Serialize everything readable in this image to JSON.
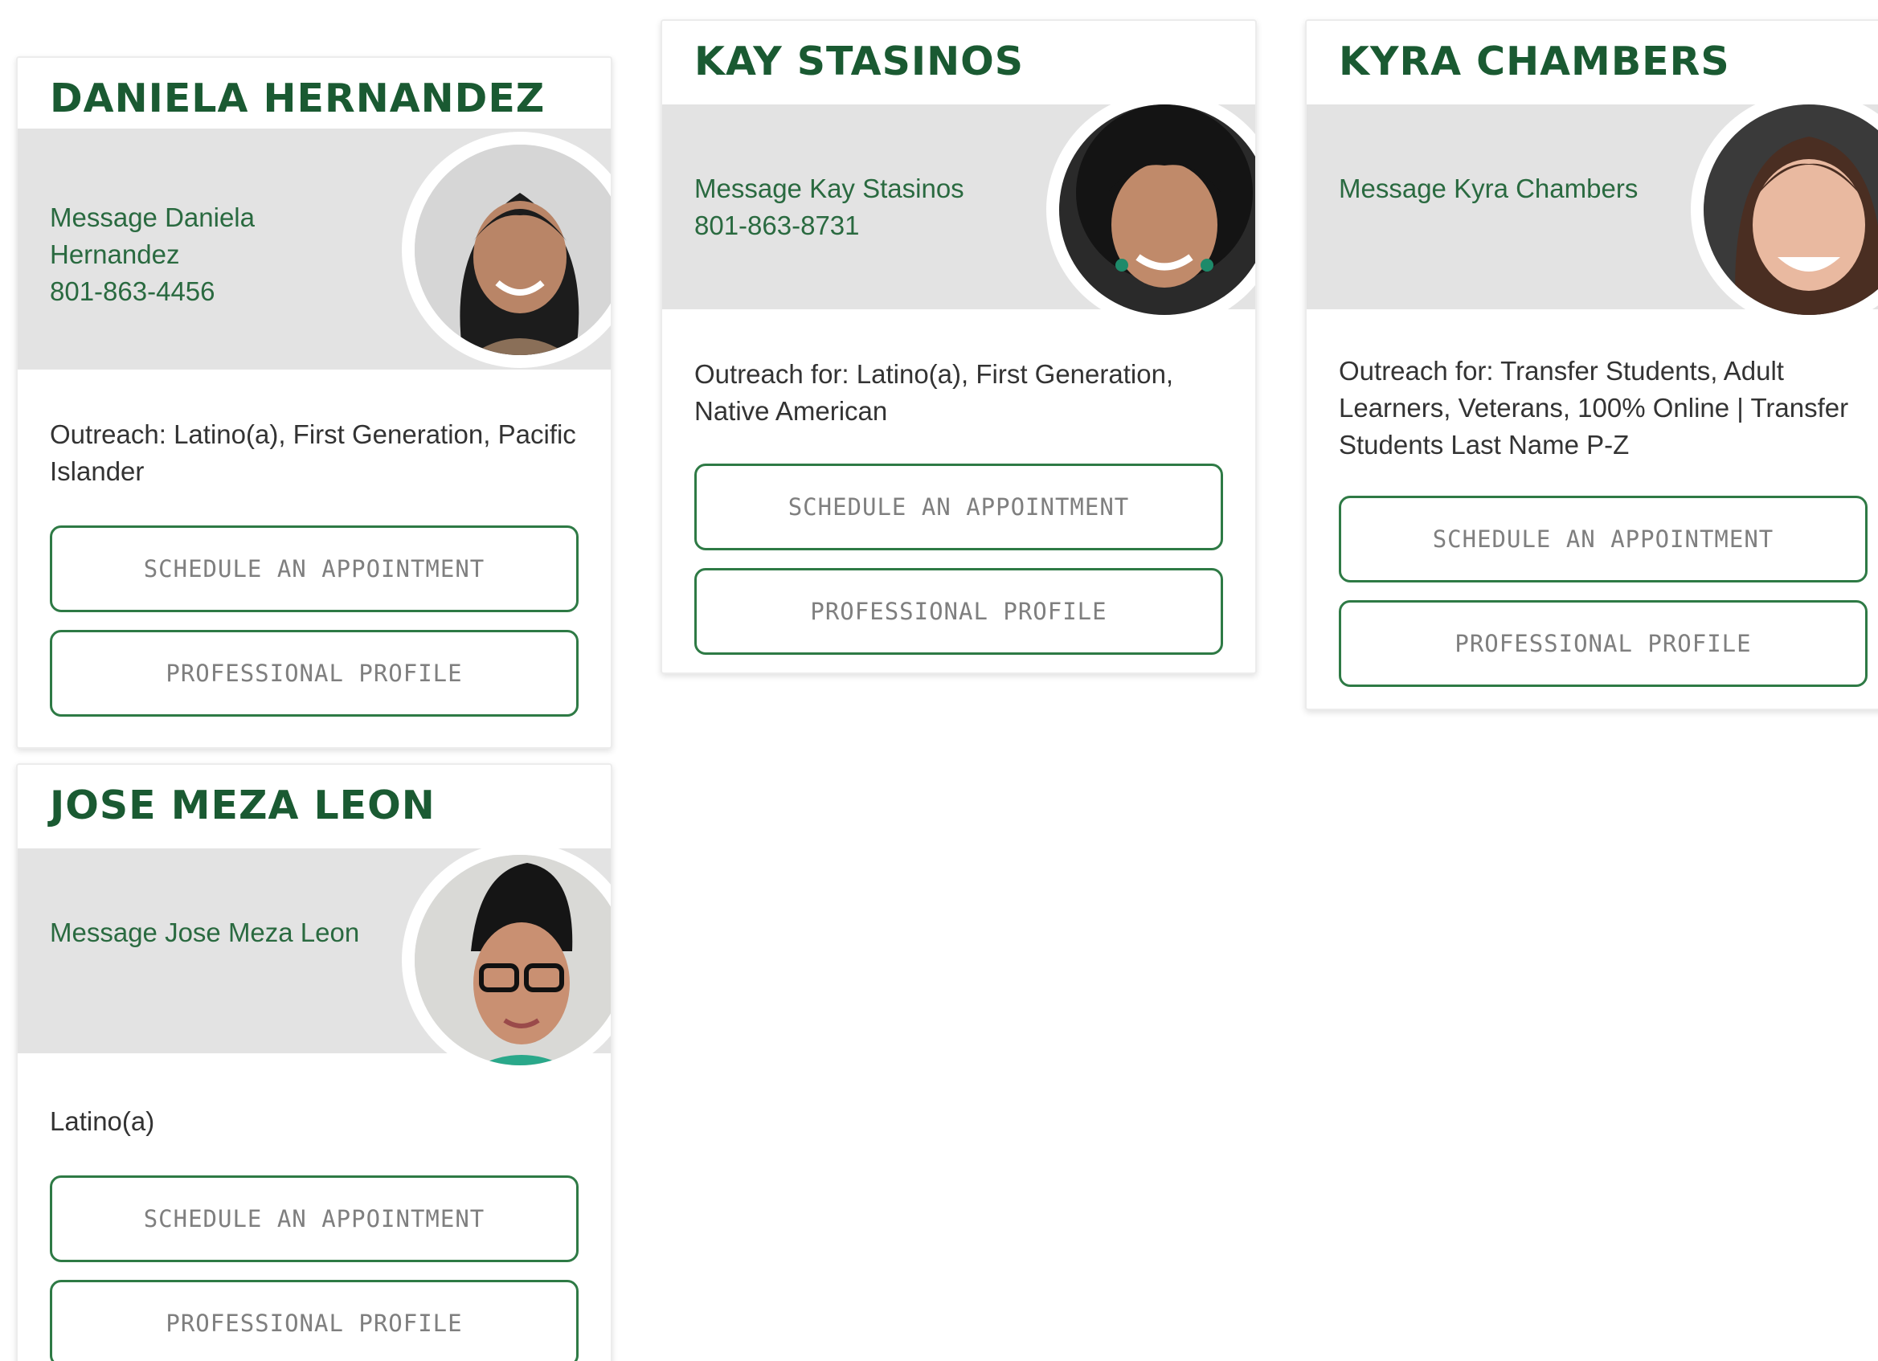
{
  "cards": [
    {
      "name": "DANIELA HERNANDEZ",
      "message_link": "Message Daniela Hernandez",
      "phone": "801-863-4456",
      "outreach": "Outreach: Latino(a), First Generation, Pacific Islander",
      "schedule_label": "SCHEDULE AN APPOINTMENT",
      "profile_label": "PROFESSIONAL PROFILE"
    },
    {
      "name": "KAY STASINOS",
      "message_link": "Message Kay Stasinos",
      "phone": "801-863-8731",
      "outreach": "Outreach for: Latino(a), First Generation, Native American",
      "schedule_label": "SCHEDULE AN APPOINTMENT",
      "profile_label": "PROFESSIONAL PROFILE"
    },
    {
      "name": "KYRA CHAMBERS",
      "message_link": "Message Kyra Chambers",
      "outreach": "Outreach for: Transfer Students, Adult Learners, Veterans, 100% Online | Transfer Students Last Name P-Z",
      "schedule_label": "SCHEDULE AN APPOINTMENT",
      "profile_label": "PROFESSIONAL PROFILE"
    },
    {
      "name": "JOSE MEZA LEON",
      "message_link": "Message Jose Meza Leon",
      "outreach": "Latino(a)",
      "schedule_label": "SCHEDULE AN APPOINTMENT",
      "profile_label": "PROFESSIONAL PROFILE"
    }
  ],
  "colors": {
    "name_green": "#1a5a32",
    "link_green": "#2a6a40",
    "button_border": "#2e7a45",
    "band_gray": "#e3e3e3"
  }
}
